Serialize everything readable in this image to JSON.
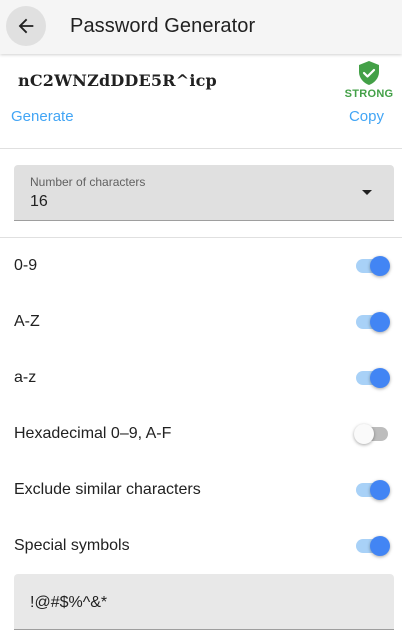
{
  "appbar": {
    "title": "Password Generator",
    "back_icon": "arrow-back-icon"
  },
  "password": {
    "value": "nC2WNZdDDE5R^icp",
    "strength_label": "STRONG",
    "strength_icon": "shield-check-icon",
    "strength_color": "#43a047"
  },
  "actions": {
    "generate_label": "Generate",
    "copy_label": "Copy",
    "accent_color": "#42a5f5"
  },
  "length_select": {
    "label": "Number of characters",
    "value": "16",
    "dropdown_icon": "arrow-drop-down-icon"
  },
  "options": [
    {
      "label": "0-9",
      "enabled": true
    },
    {
      "label": "A-Z",
      "enabled": true
    },
    {
      "label": "a-z",
      "enabled": true
    },
    {
      "label": "Hexadecimal 0–9, A-F",
      "enabled": false
    },
    {
      "label": "Exclude similar characters",
      "enabled": true
    },
    {
      "label": "Special symbols",
      "enabled": true
    }
  ],
  "symbols": {
    "value": "!@#$%^&*"
  },
  "colors": {
    "switch_on_thumb": "#4285f4",
    "switch_on_track": "#a8d1f7",
    "switch_off_thumb": "#fafafa",
    "switch_off_track": "#bdbdbd"
  }
}
